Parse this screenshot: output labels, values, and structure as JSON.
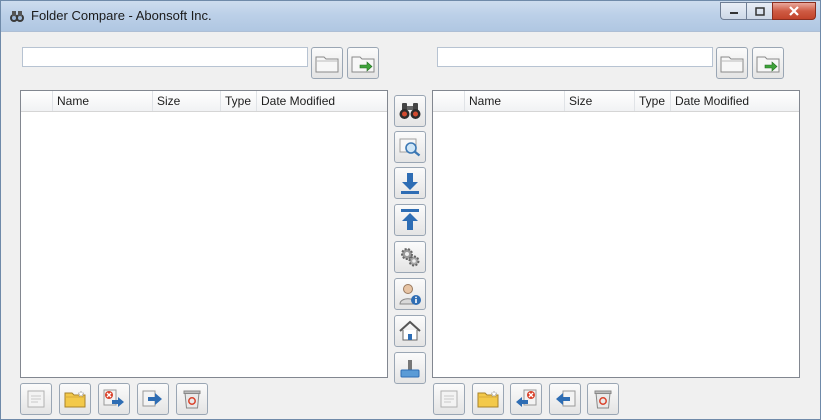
{
  "window": {
    "title": "Folder Compare - Abonsoft Inc.",
    "minimize_glyph": "–",
    "maximize_glyph": "□",
    "close_glyph": "✕"
  },
  "left": {
    "path_value": "",
    "columns": [
      "",
      "Name",
      "Size",
      "Type",
      "Date Modified"
    ]
  },
  "right": {
    "path_value": "",
    "columns": [
      "",
      "Name",
      "Size",
      "Type",
      "Date Modified"
    ]
  },
  "icons": {
    "top": [
      "browse-folder-icon",
      "open-folder-icon"
    ],
    "center": [
      "binoculars-icon",
      "search-icon",
      "copy-down-icon",
      "copy-up-icon",
      "settings-icon",
      "user-info-icon",
      "home-icon",
      "save-icon"
    ],
    "left_bottom": [
      "edit-icon",
      "new-folder-icon",
      "delete-copy-icon",
      "move-right-icon",
      "recycle-bin-icon"
    ],
    "right_bottom": [
      "edit-icon",
      "new-folder-icon",
      "delete-copy-icon",
      "move-left-icon",
      "recycle-bin-icon"
    ]
  },
  "colors": {
    "titlebar": "#bcd0e8",
    "accent_blue": "#2e6db4",
    "close_red": "#c1432b",
    "folder_yellow": "#f3c94a"
  }
}
